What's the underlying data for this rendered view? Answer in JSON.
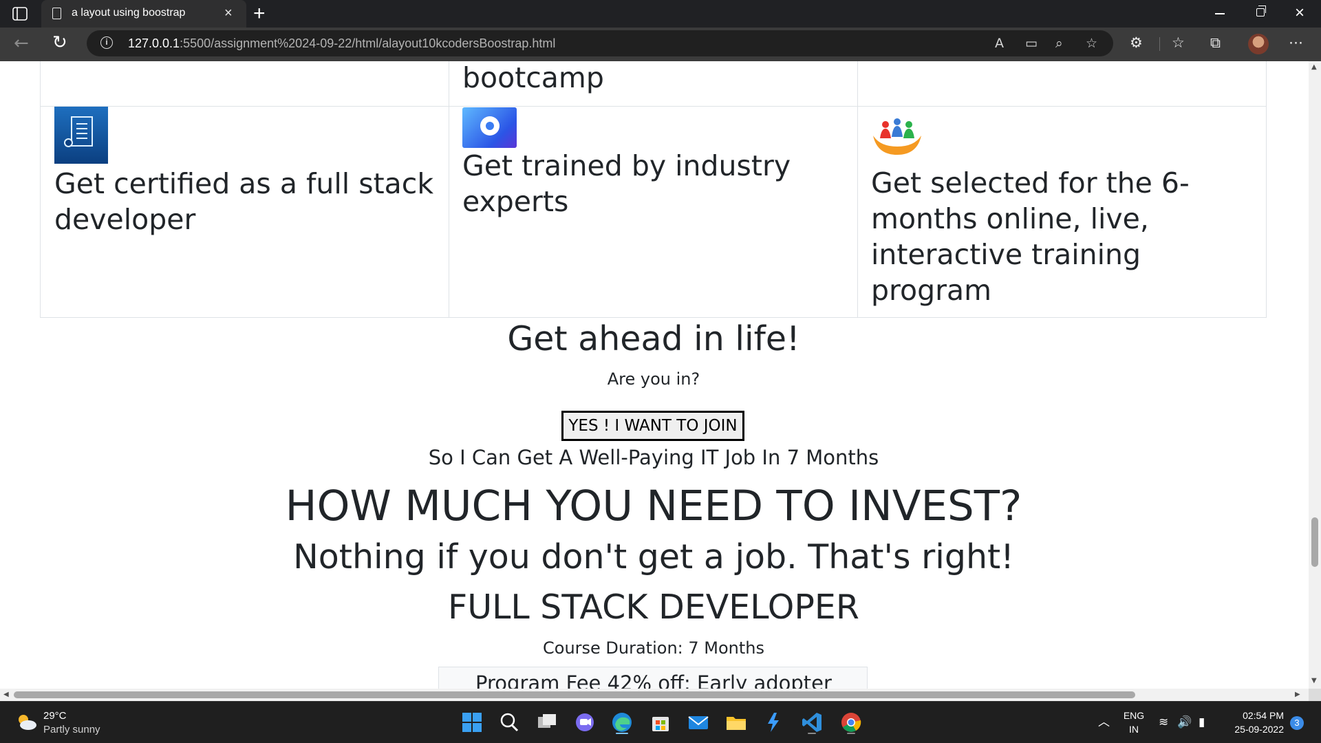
{
  "browser": {
    "tab_title": "a layout using boostrap",
    "url_host": "127.0.0.1",
    "url_path": ":5500/assignment%2024-09-22/html/alayout10kcodersBoostrap.html"
  },
  "page": {
    "top_cell_partial": "bootcamp",
    "features": [
      {
        "icon": "certificate-icon",
        "text": "Get certified as a full stack developer"
      },
      {
        "icon": "target-icon",
        "text": "Get trained by industry experts"
      },
      {
        "icon": "hands-people-icon",
        "text": "Get selected for the 6-months online, live, interactive training program"
      }
    ],
    "headline": "Get ahead in life!",
    "question": "Are you in?",
    "join_button": "YES ! I WANT TO JOIN",
    "subline": "So I Can Get A Well-Paying IT Job In 7 Months",
    "invest_heading": "HOW MUCH YOU NEED TO INVEST?",
    "nothing_heading": "Nothing if you don't get a job. That's right!",
    "course_title": "FULL STACK DEVELOPER",
    "course_duration": "Course Duration: 7 Months",
    "program_fee_partial": "Program Fee 42% off: Early adopter"
  },
  "taskbar": {
    "weather_temp": "29°C",
    "weather_desc": "Partly sunny",
    "lang_top": "ENG",
    "lang_bottom": "IN",
    "time": "02:54 PM",
    "date": "25-09-2022",
    "notification_count": "3",
    "apps": [
      "start-icon",
      "search-icon",
      "task-view-icon",
      "chat-icon",
      "edge-icon",
      "store-icon",
      "mail-icon",
      "file-explorer-icon",
      "power-automate-icon",
      "vscode-icon",
      "chrome-icon"
    ]
  },
  "colors": {
    "text": "#212529",
    "border": "#dee2e6",
    "chrome_dark": "#202124",
    "toolbar": "#3b3b3b",
    "taskbar": "#1f1f1f"
  }
}
